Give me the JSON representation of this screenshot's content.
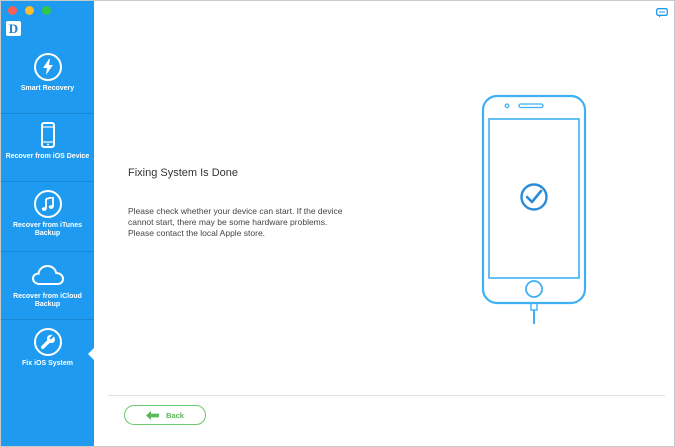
{
  "app": {
    "logo_letter": "D"
  },
  "sidebar": {
    "items": [
      {
        "label": "Smart Recovery",
        "icon": "lightning-icon"
      },
      {
        "label": "Recover from iOS Device",
        "icon": "iphone-icon"
      },
      {
        "label": "Recover from iTunes Backup",
        "icon": "music-note-icon"
      },
      {
        "label": "Recover from iCloud Backup",
        "icon": "cloud-icon"
      },
      {
        "label": "Fix iOS System",
        "icon": "wrench-icon",
        "active": true
      }
    ]
  },
  "main": {
    "title": "Fixing System Is Done",
    "message": "Please check whether your device can start. If the device cannot start, there may be some hardware problems. Please contact the local Apple store.",
    "back_label": "Back"
  },
  "colors": {
    "sidebar": "#1e9bf0",
    "phone_outline": "#3fb0f5",
    "back_button": "#6cc86c"
  }
}
